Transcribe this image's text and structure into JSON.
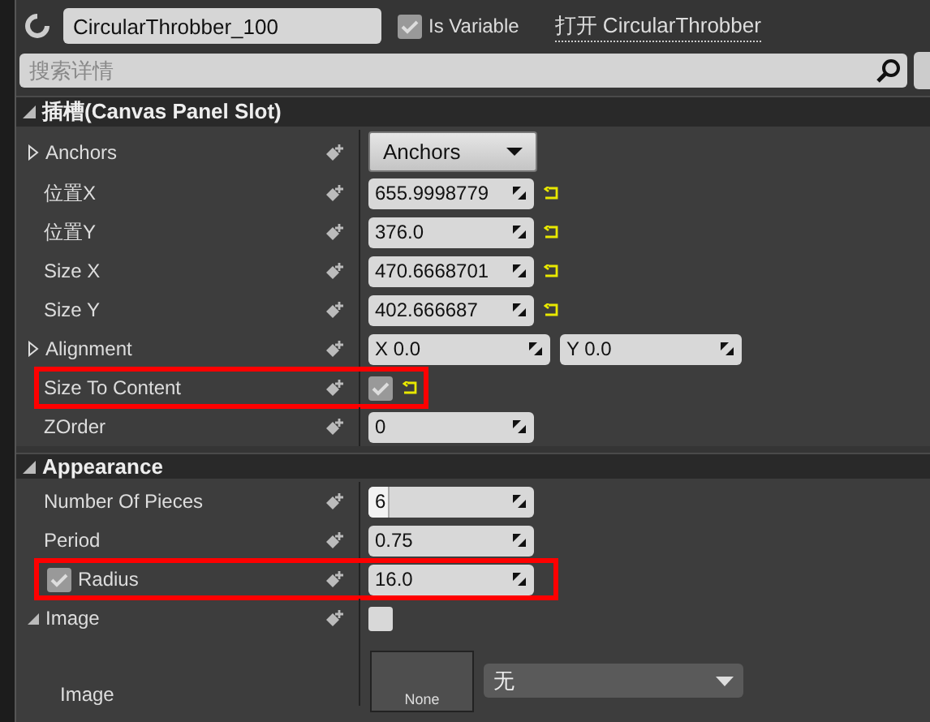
{
  "header": {
    "name": "CircularThrobber_100",
    "is_variable": {
      "label": "Is Variable",
      "checked": true
    },
    "open_link": "打开 CircularThrobber"
  },
  "search": {
    "placeholder": "搜索详情"
  },
  "sections": [
    {
      "title": "插槽(Canvas Panel Slot)",
      "expanded": true,
      "rows": [
        {
          "label": "Anchors",
          "kind": "dropdown",
          "value": "Anchors",
          "expanded": false
        },
        {
          "label": "位置X",
          "kind": "number",
          "value": "655.9998779",
          "reset": true
        },
        {
          "label": "位置Y",
          "kind": "number",
          "value": "376.0",
          "reset": true
        },
        {
          "label": "Size X",
          "kind": "number",
          "value": "470.6668701",
          "reset": true
        },
        {
          "label": "Size Y",
          "kind": "number",
          "value": "402.666687",
          "reset": true
        },
        {
          "label": "Alignment",
          "kind": "vector",
          "values": [
            "X  0.0",
            "Y  0.0"
          ],
          "expanded": false
        },
        {
          "label": "Size To Content",
          "kind": "checkbox",
          "checked": true,
          "reset": true,
          "highlighted": true
        },
        {
          "label": "ZOrder",
          "kind": "number",
          "value": "0"
        }
      ]
    },
    {
      "title": "Appearance",
      "expanded": true,
      "rows": [
        {
          "label": "Number Of Pieces",
          "kind": "slider",
          "value": "6",
          "level": 0.12
        },
        {
          "label": "Period",
          "kind": "number",
          "value": "0.75"
        },
        {
          "label": "Radius",
          "kind": "number",
          "value": "16.0",
          "label_checked": true,
          "highlighted": true
        },
        {
          "label": "Image",
          "kind": "checkbox",
          "checked": false,
          "expanded": true
        },
        {
          "label": "Image",
          "kind": "asset",
          "thumbnail": "None",
          "value": "无"
        }
      ]
    }
  ]
}
